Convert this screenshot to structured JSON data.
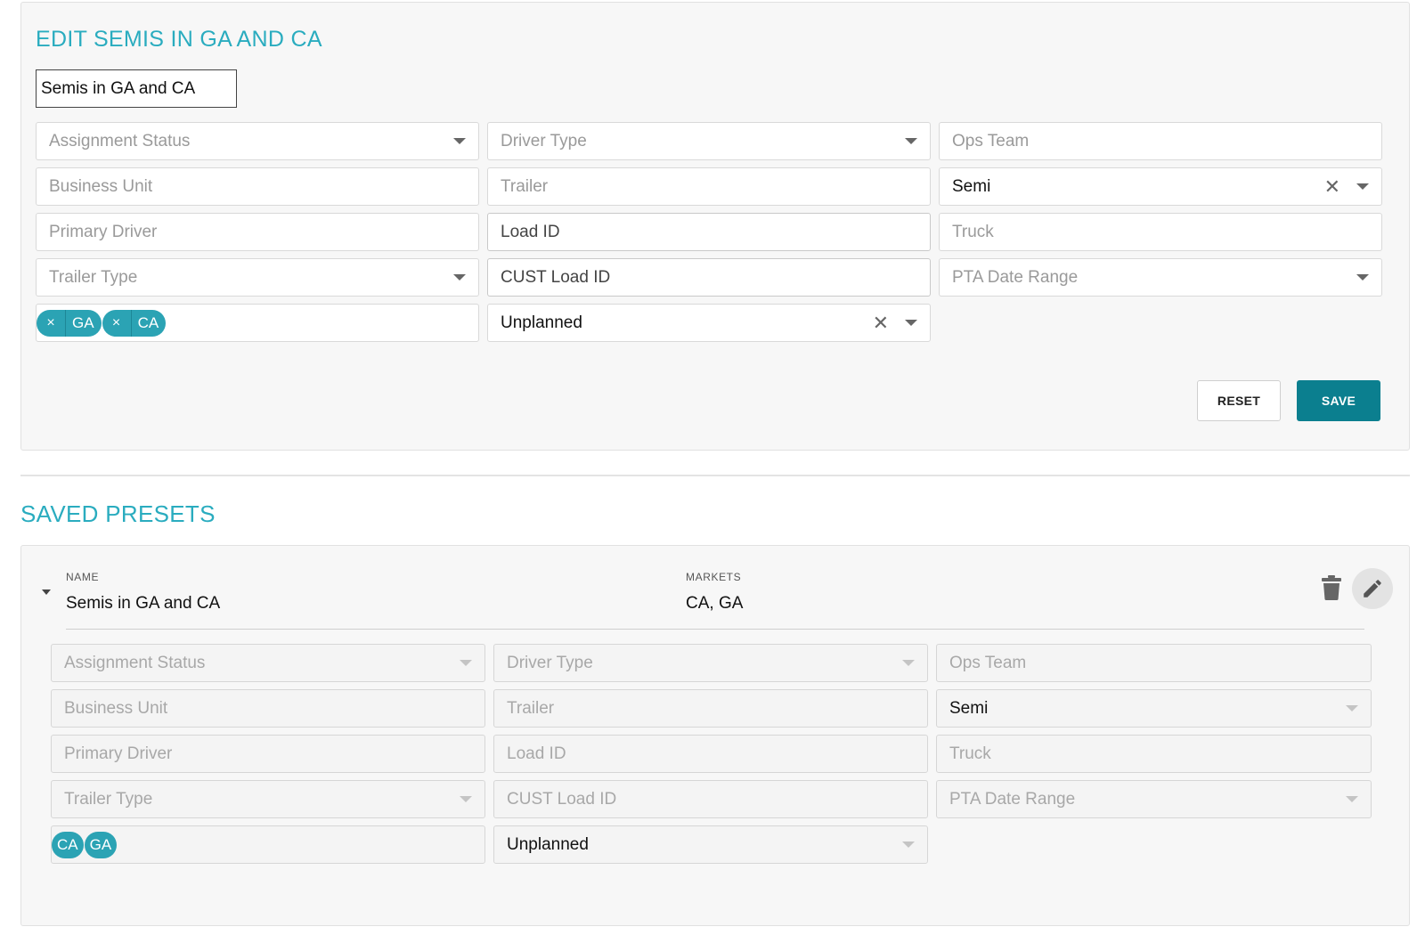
{
  "edit": {
    "title": "EDIT SEMIS IN GA AND CA",
    "name_value": "Semis in GA and CA",
    "fields": {
      "assignment_status": "Assignment Status",
      "driver_type": "Driver Type",
      "ops_team": "Ops Team",
      "business_unit": "Business Unit",
      "trailer": "Trailer",
      "trailer_kind_value": "Semi",
      "primary_driver": "Primary Driver",
      "load_id": "Load ID",
      "truck": "Truck",
      "trailer_type": "Trailer Type",
      "cust_load_id": "CUST Load ID",
      "pta_date_range": "PTA Date Range",
      "planning_value": "Unplanned"
    },
    "markets": [
      "GA",
      "CA"
    ],
    "chip_remove_glyph": "×",
    "clear_glyph": "✕",
    "reset_label": "RESET",
    "save_label": "SAVE"
  },
  "saved": {
    "title": "SAVED PRESETS",
    "preset": {
      "name_label": "NAME",
      "name_value": "Semis in GA and CA",
      "markets_label": "MARKETS",
      "markets_value": "CA, GA",
      "fields": {
        "assignment_status": "Assignment Status",
        "driver_type": "Driver Type",
        "ops_team": "Ops Team",
        "business_unit": "Business Unit",
        "trailer": "Trailer",
        "trailer_kind_value": "Semi",
        "primary_driver": "Primary Driver",
        "load_id": "Load ID",
        "truck": "Truck",
        "trailer_type": "Trailer Type",
        "cust_load_id": "CUST Load ID",
        "pta_date_range": "PTA Date Range",
        "planning_value": "Unplanned"
      },
      "markets": [
        "CA",
        "GA"
      ]
    }
  },
  "colors": {
    "accent": "#2aacbf",
    "chip": "#2ba3b4",
    "save_button": "#0b7f8f"
  }
}
